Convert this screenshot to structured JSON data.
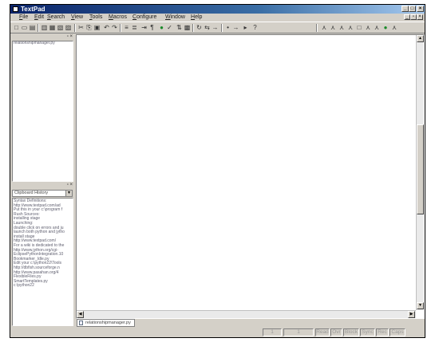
{
  "window": {
    "title": "TextPad"
  },
  "menu": [
    "File",
    "Edit",
    "Search",
    "View",
    "Tools",
    "Macros",
    "Configure",
    "Window",
    "Help"
  ],
  "toolbar": {
    "standard_glyphs": [
      "□",
      "▭",
      "▤",
      "▥",
      "▦",
      "▧",
      "▨",
      "✂",
      "⎘",
      "▣",
      "↶",
      "↷",
      "≡",
      "≣",
      "⇥",
      "¶",
      "●",
      "✓",
      "⇅",
      "▩",
      "↻",
      "⇆",
      "→",
      "•",
      "→",
      "▸",
      "?"
    ],
    "tool_glyphs": [
      "⋏",
      "⋏",
      "⋏",
      "⋏",
      "□",
      "⋏",
      "⋏",
      "●",
      "⋏"
    ]
  },
  "file_panel": {
    "files": [
      "relationshipmanager.py"
    ]
  },
  "clip_panel": {
    "library": "Clipboard History",
    "entries": [
      "Syntax Definitions:",
      "http://www.textpad.com/ad",
      "Put this in your c:\\program f",
      "Rush Sources:",
      "installing stage",
      "Launching:",
      "double click on errors and ju",
      "launch both python and jytho",
      "install stage",
      "http://www.textpad.com/",
      "For a wiki is dedicated to the",
      "http://www.jython.org/cgi-",
      "EclipsePythonIntegration.10",
      "Bookmarker_Idle.py",
      "Edit your c:\\python22\\Tools",
      "http://dbfish.sourceforge.n",
      "http://www.pasahan.org/4",
      "FlexibleFiles.py",
      "SmartTemplates.py",
      "c:\\python22"
    ]
  },
  "document_tab": {
    "label": "relationshipmanager.py"
  },
  "status": {
    "line": "1",
    "col": "1",
    "flags": [
      "Read",
      "Ovr",
      "Block",
      "Sync",
      "Rec",
      "Caps"
    ]
  }
}
